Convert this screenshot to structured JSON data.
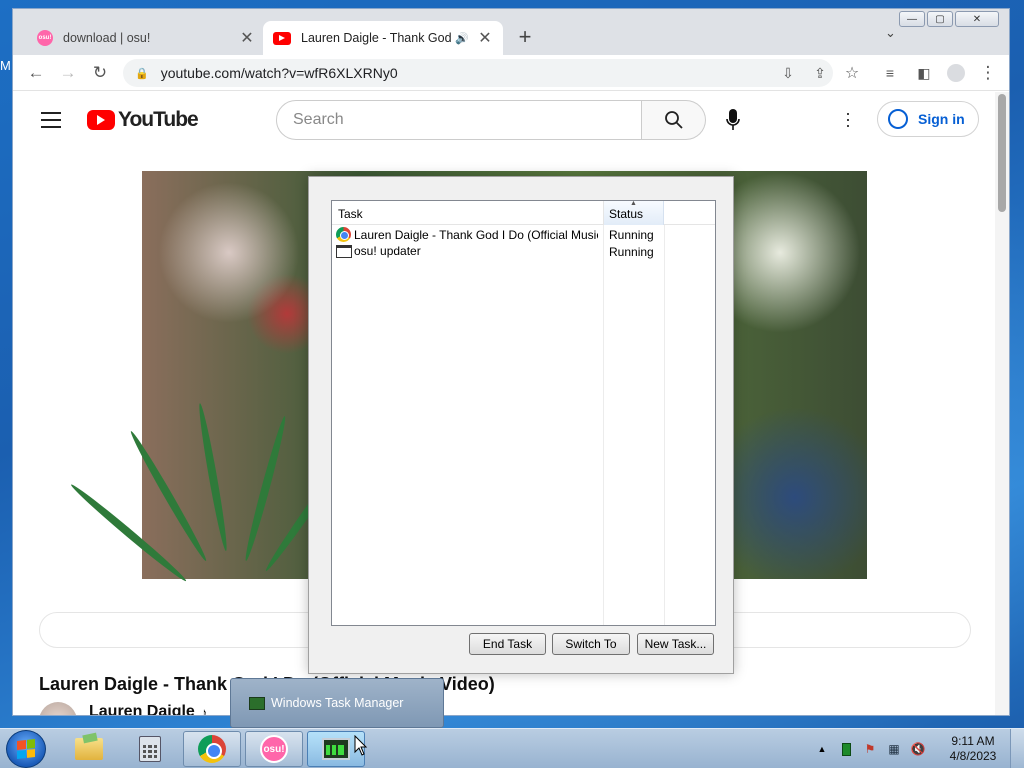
{
  "desktop": {
    "sliver_text": "M"
  },
  "browser": {
    "tabs": [
      {
        "title": "download | osu!",
        "favicon": "osu-favicon",
        "active": false
      },
      {
        "title": "Lauren Daigle - Thank God I",
        "favicon": "youtube-favicon",
        "active": true,
        "audio": true
      }
    ],
    "new_tab_label": "+",
    "address": "youtube.com/watch?v=wfR6XLXRNy0",
    "window_buttons": {
      "minimize": "—",
      "maximize": "▢",
      "close": "✕"
    }
  },
  "youtube": {
    "logo_text": "YouTube",
    "search_placeholder": "Search",
    "sign_in_label": "Sign in",
    "video_title": "Lauren Daigle - Thank God I Do (Official Music Video)",
    "channel_name": "Lauren Daigle",
    "channel_badge": "♪"
  },
  "task_manager": {
    "columns": {
      "task": "Task",
      "status": "Status"
    },
    "rows": [
      {
        "task": "Lauren Daigle - Thank God I Do (Official Music Vi...",
        "status": "Running",
        "icon": "chrome-icon"
      },
      {
        "task": "osu! updater",
        "status": "Running",
        "icon": "app-window-icon"
      }
    ],
    "buttons": {
      "end_task": "End Task",
      "switch_to": "Switch To",
      "new_task": "New Task..."
    }
  },
  "taskbar": {
    "thumbnail_title": "Windows Task Manager",
    "osu_label": "osu!",
    "clock_time": "9:11 AM",
    "clock_date": "4/8/2023"
  }
}
